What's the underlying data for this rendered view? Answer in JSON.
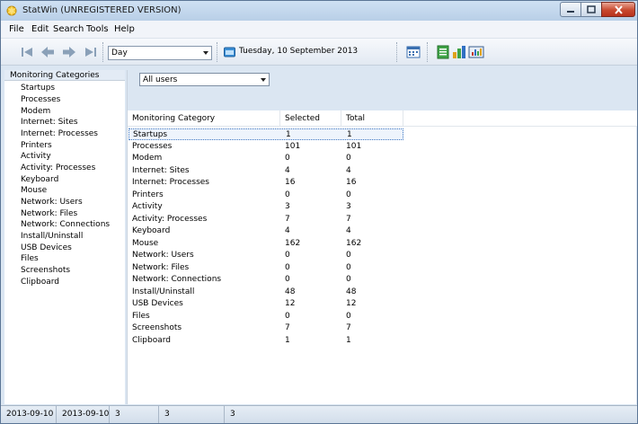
{
  "window": {
    "title": "StatWin (UNREGISTERED VERSION)"
  },
  "menu": [
    "File",
    "Edit",
    "Search",
    "Tools",
    "Help"
  ],
  "toolbar": {
    "period_value": "Day",
    "date_text": "Tuesday, 10 September 2013"
  },
  "sidebar": {
    "header": "Monitoring Categories",
    "items": [
      "Startups",
      "Processes",
      "Modem",
      "Internet: Sites",
      "Internet: Processes",
      "Printers",
      "Activity",
      "Activity: Processes",
      "Keyboard",
      "Mouse",
      "Network: Users",
      "Network: Files",
      "Network: Connections",
      "Install/Uninstall",
      "USB Devices",
      "Files",
      "Screenshots",
      "Clipboard"
    ]
  },
  "filter": {
    "users_value": "All users"
  },
  "table": {
    "columns": [
      "Monitoring Category",
      "Selected",
      "Total"
    ],
    "rows": [
      [
        "Startups",
        "1",
        "1"
      ],
      [
        "Processes",
        "101",
        "101"
      ],
      [
        "Modem",
        "0",
        "0"
      ],
      [
        "Internet: Sites",
        "4",
        "4"
      ],
      [
        "Internet: Processes",
        "16",
        "16"
      ],
      [
        "Printers",
        "0",
        "0"
      ],
      [
        "Activity",
        "3",
        "3"
      ],
      [
        "Activity: Processes",
        "7",
        "7"
      ],
      [
        "Keyboard",
        "4",
        "4"
      ],
      [
        "Mouse",
        "162",
        "162"
      ],
      [
        "Network: Users",
        "0",
        "0"
      ],
      [
        "Network: Files",
        "0",
        "0"
      ],
      [
        "Network: Connections",
        "0",
        "0"
      ],
      [
        "Install/Uninstall",
        "48",
        "48"
      ],
      [
        "USB Devices",
        "12",
        "12"
      ],
      [
        "Files",
        "0",
        "0"
      ],
      [
        "Screenshots",
        "7",
        "7"
      ],
      [
        "Clipboard",
        "1",
        "1"
      ]
    ]
  },
  "statusbar": [
    "2013-09-10",
    "2013-09-10",
    "3",
    "3",
    "3"
  ],
  "colors": {
    "accent": "#3f78c2",
    "chrome": "#dbe6f2",
    "close": "#c8492f"
  }
}
